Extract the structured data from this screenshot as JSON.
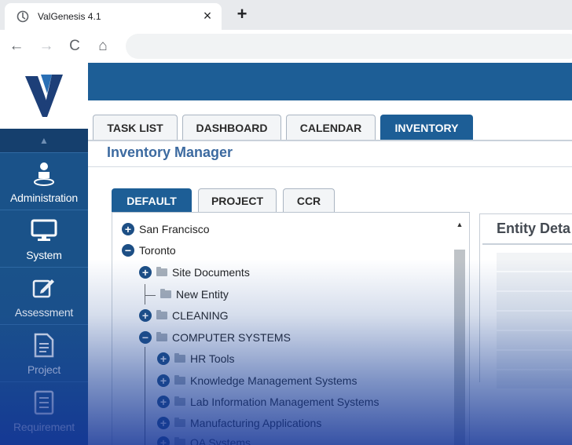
{
  "browser": {
    "tab_title": "ValGenesis 4.1",
    "close_glyph": "×",
    "new_tab_glyph": "+",
    "nav": {
      "back": "←",
      "forward": "→",
      "reload": "C",
      "home": "⌂"
    }
  },
  "app": {
    "accent_color": "#1d5e96",
    "sidebar_color": "#1a5289",
    "sidebar": {
      "collapse_glyph": "▲",
      "items": [
        {
          "label": "Administration",
          "icon": "user-admin-icon"
        },
        {
          "label": "System",
          "icon": "monitor-icon"
        },
        {
          "label": "Assessment",
          "icon": "edit-icon"
        },
        {
          "label": "Project",
          "icon": "document-icon"
        },
        {
          "label": "Requirement",
          "icon": "list-icon"
        }
      ]
    },
    "main_tabs": [
      {
        "label": "TASK LIST",
        "active": false
      },
      {
        "label": "DASHBOARD",
        "active": false
      },
      {
        "label": "CALENDAR",
        "active": false
      },
      {
        "label": "INVENTORY",
        "active": true
      }
    ],
    "page_title": "Inventory Manager",
    "sub_tabs": [
      {
        "label": "DEFAULT",
        "active": true
      },
      {
        "label": "PROJECT",
        "active": false
      },
      {
        "label": "CCR",
        "active": false
      }
    ],
    "tree": {
      "scroll_up_glyph": "▲",
      "nodes": [
        {
          "label": "San Francisco",
          "expander": "+"
        },
        {
          "label": "Toronto",
          "expander": "−"
        },
        {
          "label": "Site Documents",
          "expander": "+"
        },
        {
          "label": "New Entity"
        },
        {
          "label": "CLEANING",
          "expander": "+"
        },
        {
          "label": "COMPUTER SYSTEMS",
          "expander": "−"
        },
        {
          "label": "HR Tools",
          "expander": "+"
        },
        {
          "label": "Knowledge Management Systems",
          "expander": "+"
        },
        {
          "label": "Lab Information Management Systems",
          "expander": "+"
        },
        {
          "label": "Manufacturing Applications",
          "expander": "+"
        },
        {
          "label": "QA Systems",
          "expander": "+"
        }
      ]
    },
    "details": {
      "title": "Entity Deta"
    }
  }
}
